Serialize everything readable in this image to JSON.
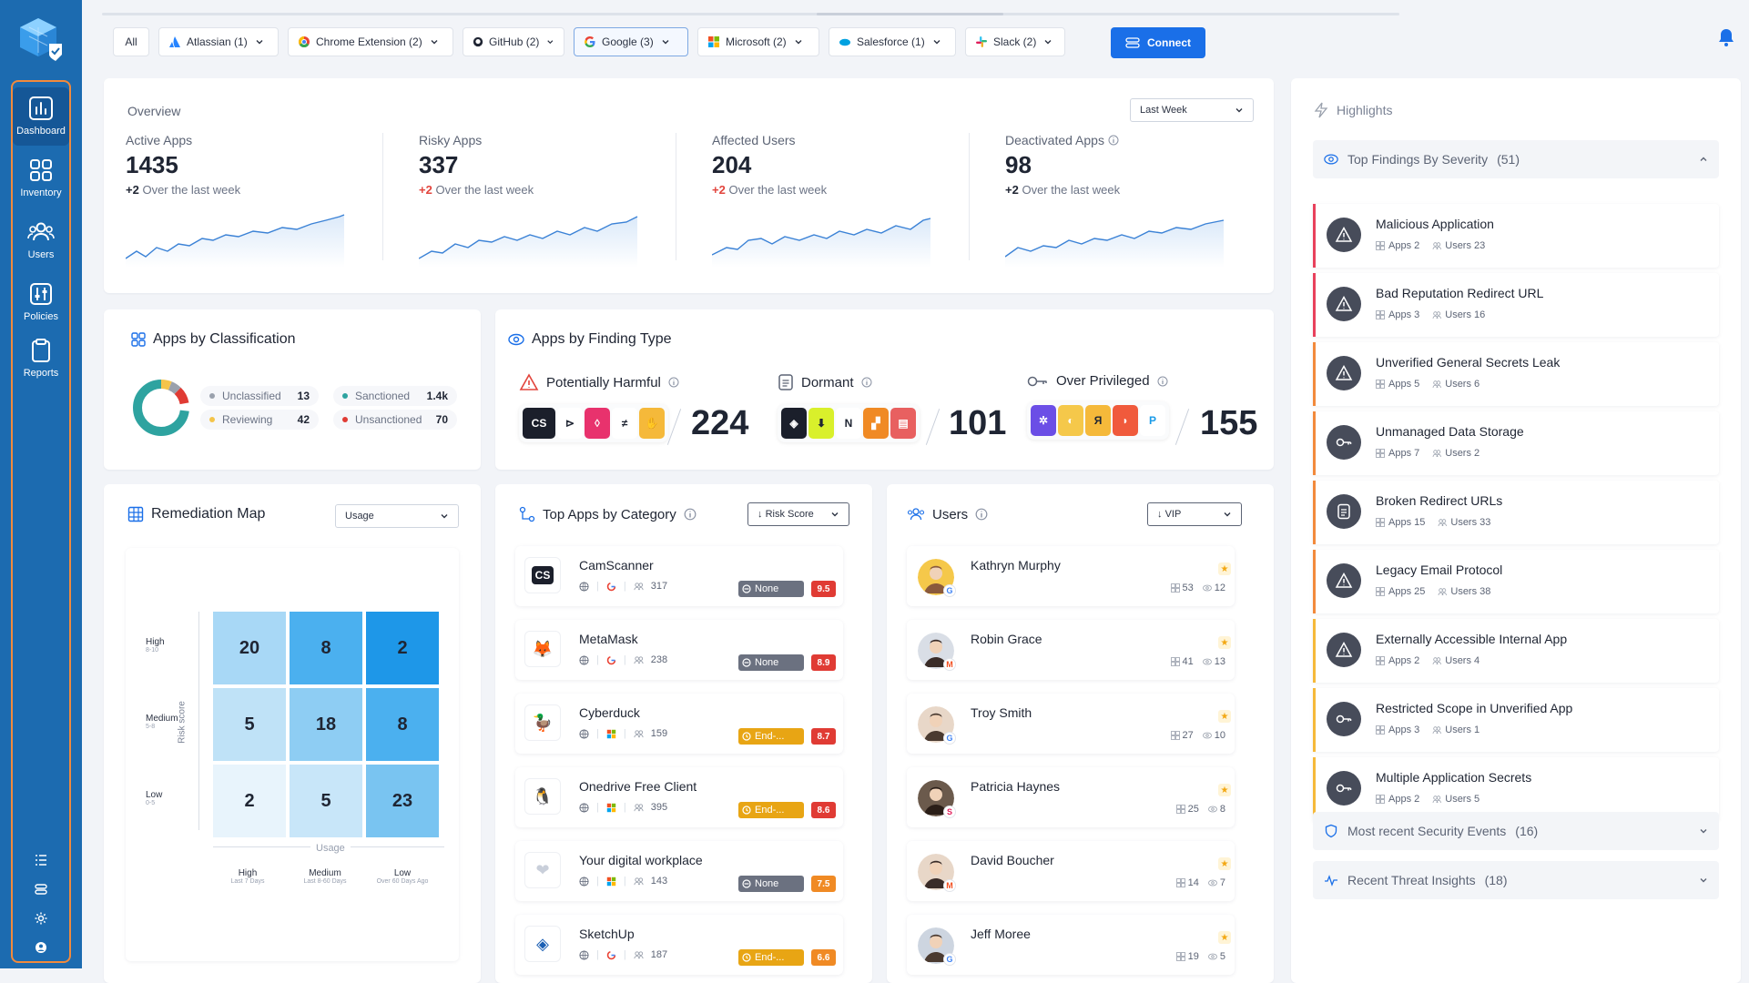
{
  "sidebar": {
    "items": [
      {
        "label": "Dashboard",
        "icon": "bar-chart-icon"
      },
      {
        "label": "Inventory",
        "icon": "grid-icon"
      },
      {
        "label": "Users",
        "icon": "users-icon"
      },
      {
        "label": "Policies",
        "icon": "sliders-icon"
      },
      {
        "label": "Reports",
        "icon": "clipboard-icon"
      }
    ]
  },
  "filters": {
    "all_label": "All",
    "chips": [
      {
        "label": "Atlassian (1)",
        "icon": "atlassian-icon"
      },
      {
        "label": "Chrome Extension (2)",
        "icon": "chrome-icon"
      },
      {
        "label": "GitHub (2)",
        "icon": "github-icon"
      },
      {
        "label": "Google (3)",
        "icon": "google-icon"
      },
      {
        "label": "Microsoft (2)",
        "icon": "microsoft-icon"
      },
      {
        "label": "Salesforce (1)",
        "icon": "salesforce-icon"
      },
      {
        "label": "Slack (2)",
        "icon": "slack-icon"
      }
    ],
    "connect_label": "Connect"
  },
  "overview": {
    "title": "Overview",
    "period": "Last Week",
    "stats": [
      {
        "name": "Active Apps",
        "value": "1435",
        "delta": "+2",
        "delta_text": "Over the last week",
        "delta_color": "#1f2533"
      },
      {
        "name": "Risky Apps",
        "value": "337",
        "delta": "+2",
        "delta_text": "Over the last week",
        "delta_color": "#e2443c"
      },
      {
        "name": "Affected Users",
        "value": "204",
        "delta": "+2",
        "delta_text": "Over the last week",
        "delta_color": "#e2443c"
      },
      {
        "name": "Deactivated Apps",
        "value": "98",
        "delta": "+2",
        "delta_text": "Over the last week",
        "delta_color": "#1f2533"
      }
    ]
  },
  "classification": {
    "title": "Apps by Classification",
    "rows": [
      {
        "label": "Unclassified",
        "value": "13",
        "color": "#9aa1ad"
      },
      {
        "label": "Sanctioned",
        "value": "1.4k",
        "color": "#2ea3a0"
      },
      {
        "label": "Reviewing",
        "value": "42",
        "color": "#f4c44a"
      },
      {
        "label": "Unsanctioned",
        "value": "70",
        "color": "#e03b34"
      }
    ]
  },
  "finding_type": {
    "title": "Apps by Finding Type",
    "groups": [
      {
        "label": "Potentially Harmful",
        "count": "224"
      },
      {
        "label": "Dormant",
        "count": "101"
      },
      {
        "label": "Over Privileged",
        "count": "155"
      }
    ]
  },
  "remediation": {
    "title": "Remediation Map",
    "selector": "Usage",
    "y_axis": "Risk score",
    "x_axis": "Usage",
    "rows": [
      {
        "label": "High",
        "sub": "8-10",
        "cells": [
          20,
          8,
          2
        ]
      },
      {
        "label": "Medium",
        "sub": "5-8",
        "cells": [
          5,
          18,
          8
        ]
      },
      {
        "label": "Low",
        "sub": "0-5",
        "cells": [
          2,
          5,
          23
        ]
      }
    ],
    "cols": [
      {
        "label": "High",
        "sub": "Last 7 Days"
      },
      {
        "label": "Medium",
        "sub": "Last 8-60 Days"
      },
      {
        "label": "Low",
        "sub": "Over 60 Days Ago"
      }
    ],
    "colors": [
      "#e8f4fc",
      "#bfe2f7",
      "#8ecdf3",
      "#4bb0ef",
      "#1e97e8"
    ]
  },
  "top_apps": {
    "title": "Top Apps by Category",
    "sort": "Risk Score",
    "apps": [
      {
        "name": "CamScanner",
        "icons": "globe,google",
        "users": "317",
        "status": "None",
        "status_type": "none",
        "score": "9.5",
        "score_type": "red"
      },
      {
        "name": "MetaMask",
        "icons": "globe,google",
        "users": "238",
        "status": "None",
        "status_type": "none",
        "score": "8.9",
        "score_type": "red"
      },
      {
        "name": "Cyberduck",
        "icons": "globe,microsoft",
        "users": "159",
        "status": "End-...",
        "status_type": "end",
        "score": "8.7",
        "score_type": "red"
      },
      {
        "name": "Onedrive Free Client",
        "icons": "globe,microsoft",
        "users": "395",
        "status": "End-...",
        "status_type": "end",
        "score": "8.6",
        "score_type": "red"
      },
      {
        "name": "Your digital workplace",
        "icons": "globe,microsoft",
        "users": "143",
        "status": "None",
        "status_type": "none",
        "score": "7.5",
        "score_type": "orange"
      },
      {
        "name": "SketchUp",
        "icons": "globe,google",
        "users": "187",
        "status": "End-...",
        "status_type": "end",
        "score": "6.6",
        "score_type": "orange"
      }
    ]
  },
  "users": {
    "title": "Users",
    "filter": "VIP",
    "list": [
      {
        "name": "Kathryn Murphy",
        "apps": "53",
        "findings": "12",
        "badge": "G"
      },
      {
        "name": "Robin Grace",
        "apps": "41",
        "findings": "13",
        "badge": "M"
      },
      {
        "name": "Troy Smith",
        "apps": "27",
        "findings": "10",
        "badge": "G"
      },
      {
        "name": "Patricia Haynes",
        "apps": "25",
        "findings": "8",
        "badge": "S"
      },
      {
        "name": "David Boucher",
        "apps": "14",
        "findings": "7",
        "badge": "M"
      },
      {
        "name": "Jeff Moree",
        "apps": "19",
        "findings": "5",
        "badge": "G"
      }
    ]
  },
  "highlights": {
    "title": "Highlights",
    "top_findings": "Top Findings By Severity",
    "top_findings_count": "(51)",
    "items": [
      {
        "title": "Malicious Application",
        "apps": "Apps 2",
        "users": "Users 23",
        "icon": "warning-icon",
        "color": "#e8415c"
      },
      {
        "title": "Bad Reputation Redirect URL",
        "apps": "Apps 3",
        "users": "Users 16",
        "icon": "warning-icon",
        "color": "#e8415c"
      },
      {
        "title": "Unverified General Secrets Leak",
        "apps": "Apps 5",
        "users": "Users 6",
        "icon": "warning-icon",
        "color": "#f28a3c"
      },
      {
        "title": "Unmanaged Data Storage",
        "apps": "Apps 7",
        "users": "Users 2",
        "icon": "key-icon",
        "color": "#f28a3c"
      },
      {
        "title": "Broken Redirect URLs",
        "apps": "Apps 15",
        "users": "Users 33",
        "icon": "document-icon",
        "color": "#f28a3c"
      },
      {
        "title": "Legacy Email Protocol",
        "apps": "Apps 25",
        "users": "Users 38",
        "icon": "warning-icon",
        "color": "#f28a3c"
      },
      {
        "title": "Externally Accessible Internal App",
        "apps": "Apps 2",
        "users": "Users 4",
        "icon": "warning-icon",
        "color": "#f5b93a"
      },
      {
        "title": "Restricted Scope in Unverified App",
        "apps": "Apps 3",
        "users": "Users 1",
        "icon": "key-icon",
        "color": "#f5b93a"
      },
      {
        "title": "Multiple Application Secrets",
        "apps": "Apps 2",
        "users": "Users 5",
        "icon": "key-icon",
        "color": "#f5b93a"
      }
    ],
    "security_events": "Most recent Security Events",
    "security_events_count": "(16)",
    "threat_insights": "Recent Threat Insights",
    "threat_insights_count": "(18)"
  }
}
